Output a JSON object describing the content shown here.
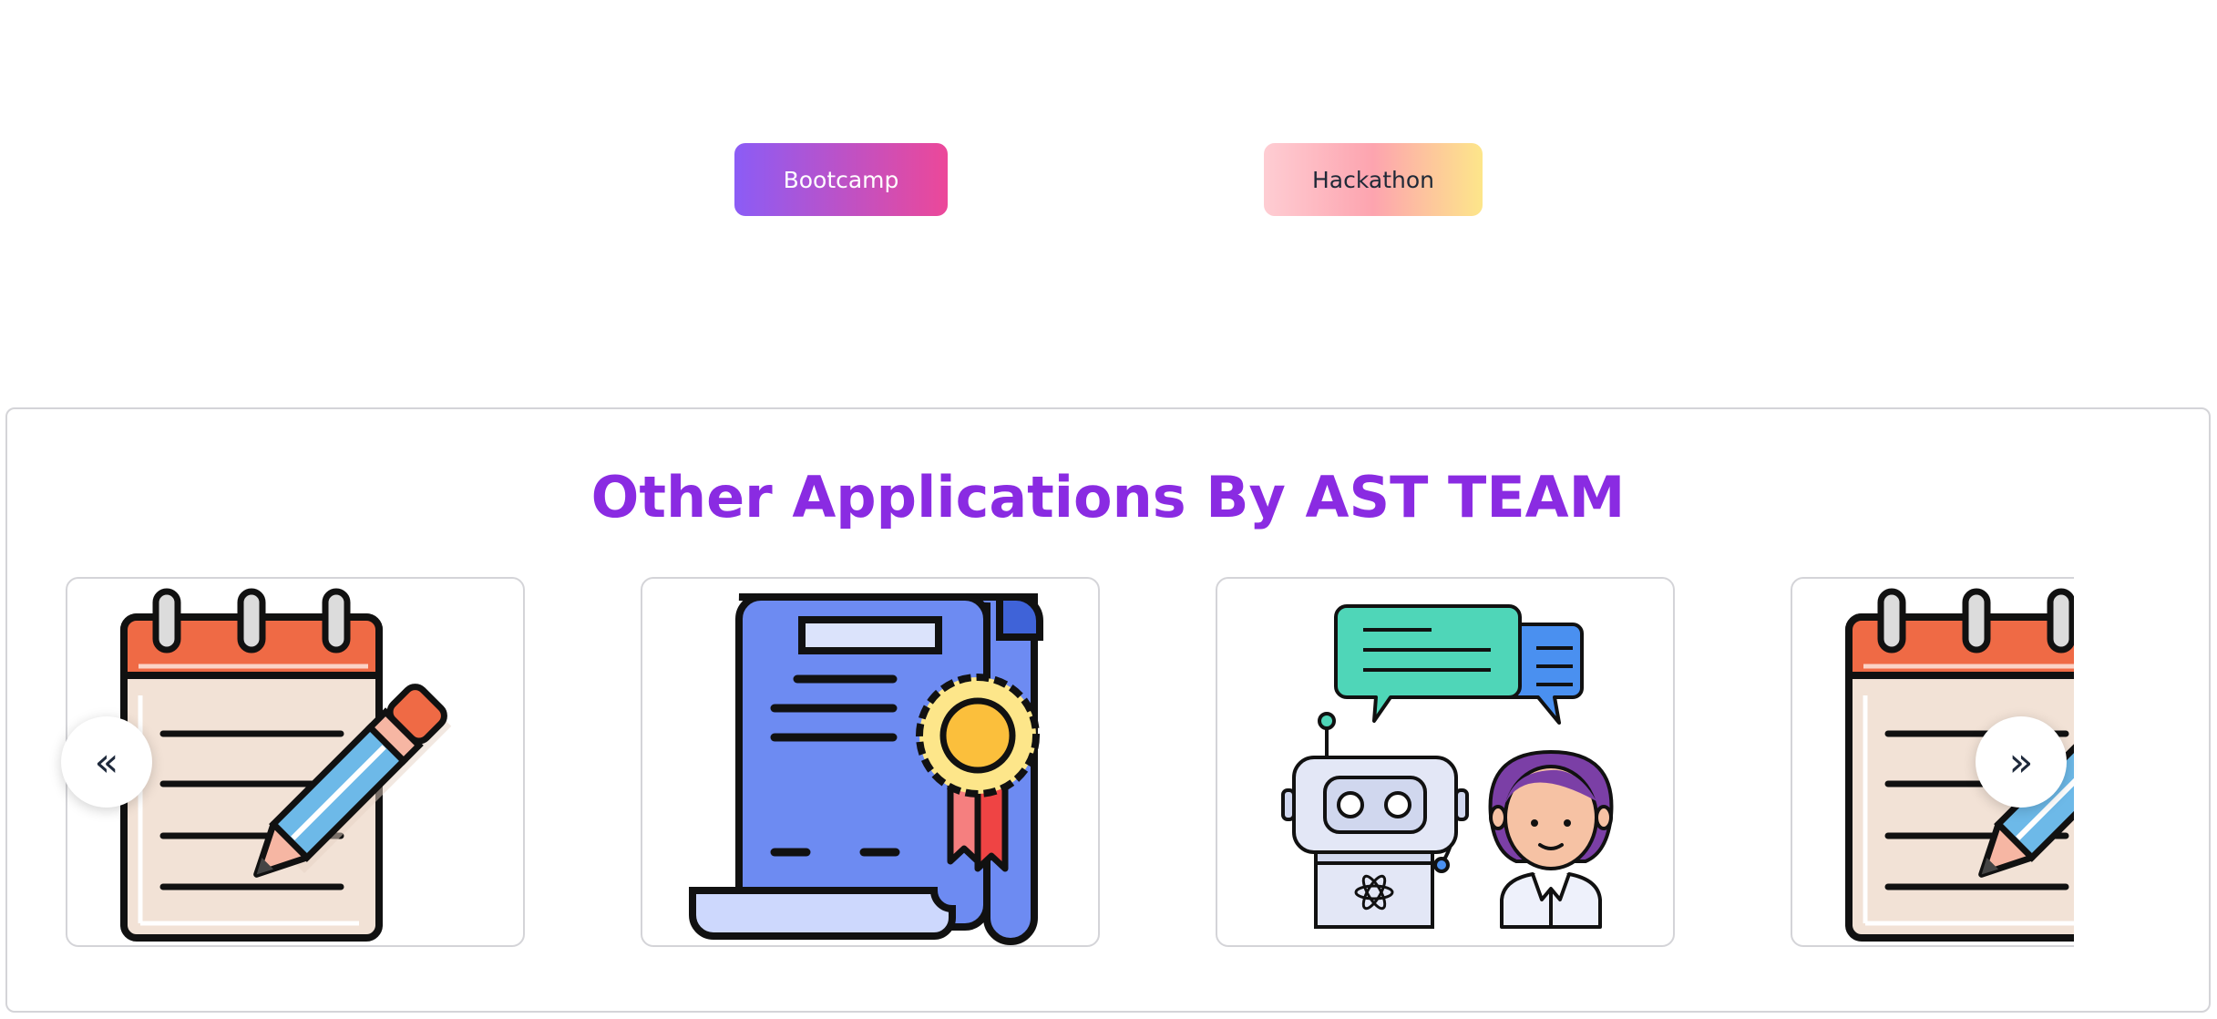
{
  "tags": {
    "bootcamp_label": "Bootcamp",
    "hackathon_label": "Hackathon"
  },
  "apps_section": {
    "title": "Other Applications By AST TEAM",
    "title_color": "#8a2be2",
    "cards": [
      {
        "icon": "notepad-pencil-icon"
      },
      {
        "icon": "certificate-scroll-icon"
      },
      {
        "icon": "chatbot-conversation-icon"
      },
      {
        "icon": "notepad-pencil-icon"
      }
    ],
    "prev_icon": "chevron-double-left-icon",
    "next_icon": "chevron-double-right-icon",
    "prev_glyph": "«",
    "next_glyph": "»"
  },
  "colors": {
    "bootcamp_gradient": [
      "#8b5cf6",
      "#ec4899"
    ],
    "hackathon_gradient": [
      "#fecdd3",
      "#fda4af",
      "#fde68a"
    ]
  }
}
